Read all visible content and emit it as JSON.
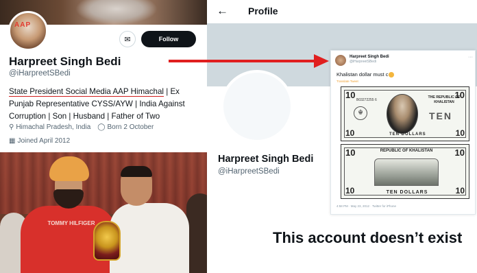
{
  "left_profile": {
    "display_name": "Harpreet Singh Bedi",
    "handle": "@iHarpreetSBedi",
    "follow_label": "Follow",
    "message_icon": "mail-icon",
    "bio_underlined": "State President Social Media AAP Himachal",
    "bio_rest": " | Ex Punjab Representative CYSS/AYW | India Against Corruption | Son | Husband | Father of Two",
    "location": "Himachal Pradesh, India",
    "born": "Born 2 October",
    "joined": "Joined April 2012",
    "location_icon": "location-pin-icon",
    "born_icon": "balloon-icon",
    "joined_icon": "calendar-icon",
    "photo_shirt_text": "TOMMY HILFIGER"
  },
  "right_profile": {
    "back_icon": "arrow-left-icon",
    "header_title": "Profile",
    "display_name": "Harpreet Singh Bedi",
    "handle": "@iHarpreetSBedi",
    "empty_state": "This account doesn’t exist"
  },
  "tweet": {
    "author_name": "Harpreet Singh Bedi",
    "author_handle": "@iHarpreetSBedi",
    "text": "Khalistan dollar must c",
    "translate_label": "Translate Tweet",
    "timestamp": "4:58 PM · May 23, 2012 · Twitter for iPhone",
    "note_top": {
      "denomination": "10",
      "serial": "B03272255 6",
      "republic": "THE REPUBLIC OF KHALISTAN",
      "big_word": "TEN",
      "amount_words": "TEN DOLLARS"
    },
    "note_bottom": {
      "denomination": "10",
      "republic": "REPUBLIC OF KHALISTAN",
      "amount_words": "TEN DOLLARS"
    }
  },
  "colors": {
    "arrow": "#e01f1f",
    "underline": "#d01b1b",
    "follow_bg": "#0f1419",
    "muted": "#536471"
  }
}
